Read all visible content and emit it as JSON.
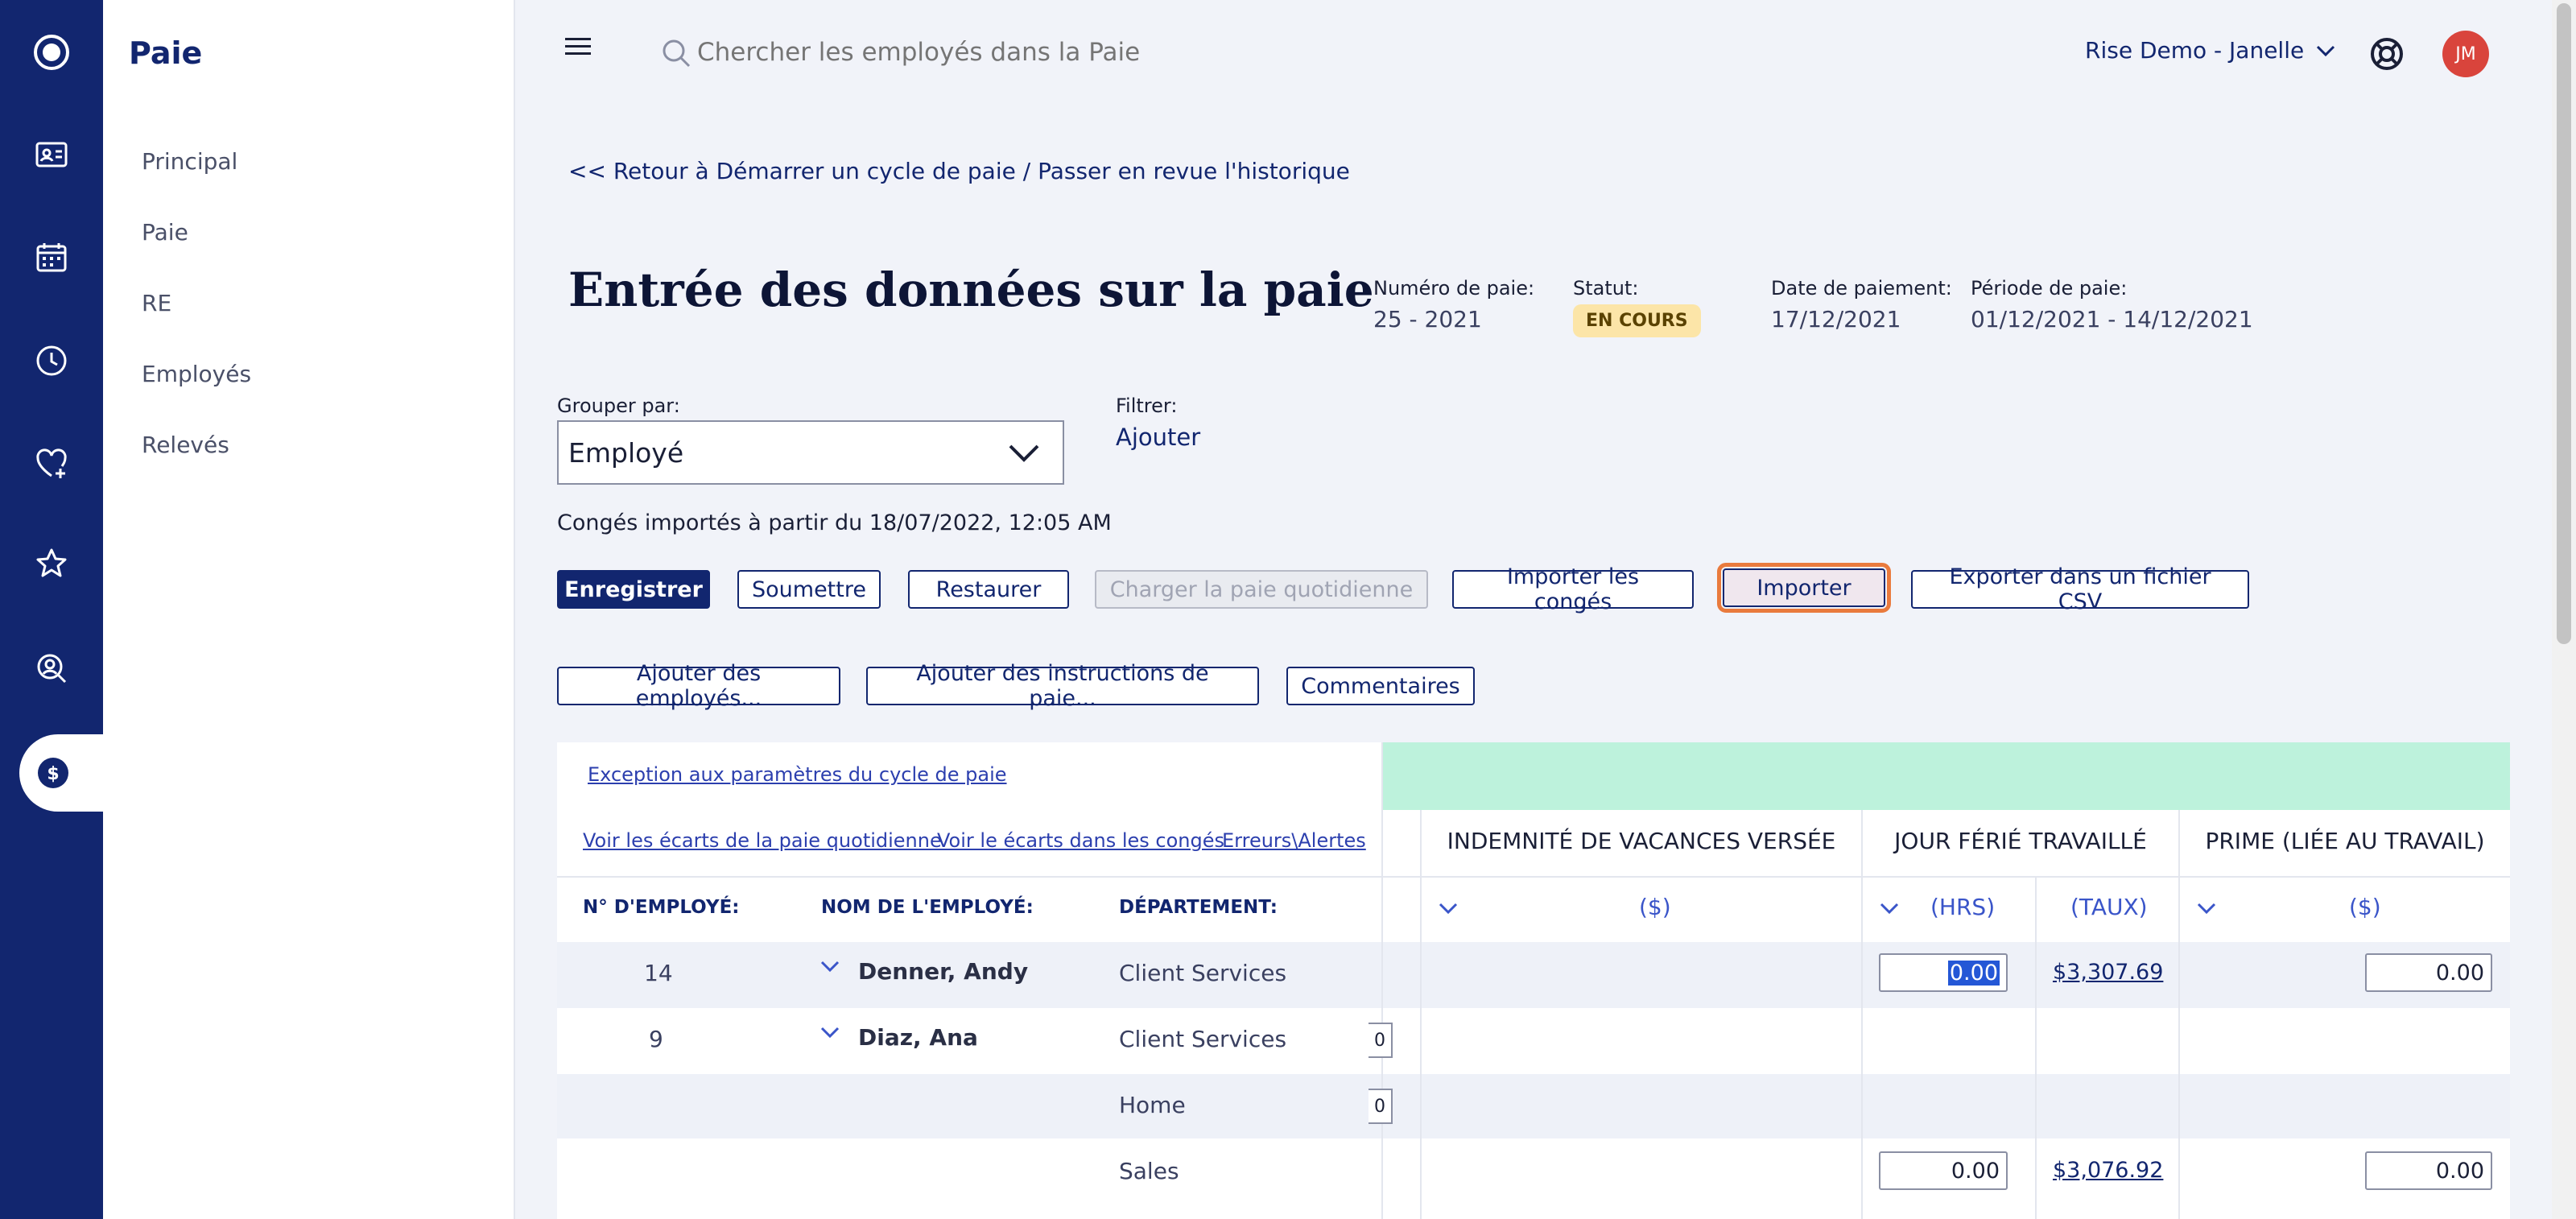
{
  "rail": {
    "items": [
      {
        "icon": "logo-icon"
      },
      {
        "icon": "id-card-icon"
      },
      {
        "icon": "calendar-icon"
      },
      {
        "icon": "clock-icon"
      },
      {
        "icon": "heart-plus-icon"
      },
      {
        "icon": "star-icon"
      },
      {
        "icon": "person-search-icon"
      },
      {
        "icon": "dollar-icon",
        "active": true
      }
    ]
  },
  "sidenav": {
    "title": "Paie",
    "items": [
      "Principal",
      "Paie",
      "RE",
      "Employés",
      "Relevés"
    ]
  },
  "topbar": {
    "search_placeholder": "Chercher les employés dans la Paie",
    "company": "Rise Demo - Janelle",
    "avatar_initials": "JM"
  },
  "back_link": "<< Retour à Démarrer un cycle de paie / Passer en revue l'historique",
  "page_title": "Entrée des données sur la paie",
  "meta": {
    "pay_number_label": "Numéro de paie:",
    "pay_number": "25 - 2021",
    "status_label": "Statut:",
    "status": "EN COURS",
    "pay_date_label": "Date de paiement:",
    "pay_date": "17/12/2021",
    "period_label": "Période de paie:",
    "period": "01/12/2021 - 14/12/2021"
  },
  "group_by": {
    "label": "Grouper par:",
    "value": "Employé"
  },
  "filter": {
    "label": "Filtrer:",
    "add": "Ajouter"
  },
  "import_note": "Congés importés à partir du 18/07/2022, 12:05 AM",
  "buttons_row1": {
    "save": "Enregistrer",
    "submit": "Soumettre",
    "restore": "Restaurer",
    "load_daily": "Charger la paie quotidienne",
    "import_leave": "Importer les congés",
    "import": "Importer",
    "export_csv": "Exporter dans un fichier CSV"
  },
  "buttons_row2": {
    "add_employees": "Ajouter des employés...",
    "add_instructions": "Ajouter des instructions de paie...",
    "comments": "Commentaires"
  },
  "table": {
    "exception_link": "Exception aux paramètres du cycle de paie",
    "links": [
      "Voir les écarts de la paie quotidienne",
      "Voir le écarts dans les congés",
      "Erreurs\\Alertes"
    ],
    "col_headers": {
      "emp_no": "N° D'EMPLOYÉ:",
      "emp_name": "NOM DE L'EMPLOYÉ:",
      "department": "DÉPARTEMENT:"
    },
    "groups": {
      "vacation": "INDEMNITÉ DE VACANCES VERSÉE",
      "holiday": "JOUR FÉRIÉ TRAVAILLÉ",
      "bonus": "PRIME (LIÉE AU TRAVAIL)"
    },
    "subheaders": {
      "vacation": "($)",
      "holiday_hrs": "(HRS)",
      "holiday_rate": "(TAUX)",
      "bonus": "($)"
    },
    "rows": [
      {
        "emp_no": "14",
        "name": "Denner, Andy",
        "department": "Client Services",
        "holiday_hrs": "0.00",
        "holiday_rate": "$3,307.69",
        "bonus": "0.00"
      },
      {
        "emp_no": "9",
        "name": "Diaz, Ana",
        "department": "Client Services",
        "stub": "0"
      },
      {
        "emp_no": "",
        "name": "",
        "department": "Home",
        "stub": "0"
      },
      {
        "emp_no": "",
        "name": "",
        "department": "Sales",
        "holiday_hrs": "0.00",
        "holiday_rate": "$3,076.92",
        "bonus": "0.00"
      }
    ]
  }
}
